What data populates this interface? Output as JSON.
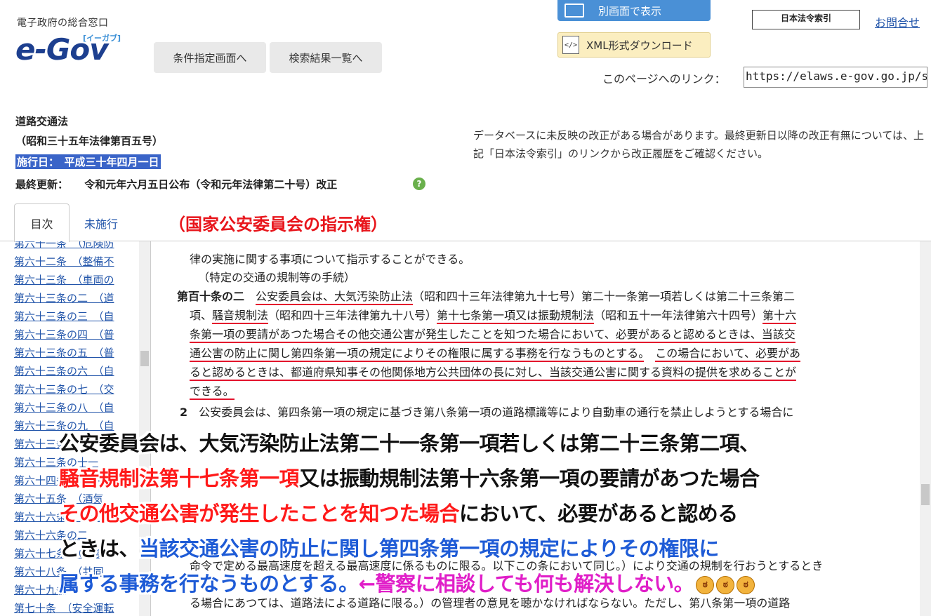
{
  "header": {
    "logo_sub": "電子政府の総合窓口",
    "logo_main": "e-Gov",
    "logo_kana": "[イーガブ]",
    "btn_condition": "条件指定画面へ",
    "btn_results": "検索結果一覧へ",
    "btn_new_window": "別画面で表示",
    "btn_xml": "XML形式ダウンロード",
    "hourei_logo": "日本法令索引",
    "contact": "お問合せ",
    "page_link_label": "このページへのリンク：",
    "page_link_value": "https://elaws.e-gov.go.jp/sea"
  },
  "law": {
    "title": "道路交通法",
    "number": "（昭和三十五年法律第百五号）",
    "effective": "施行日：　平成三十年四月一日",
    "update_label": "最終更新：",
    "update_value": "令和元年六月五日公布（令和元年法律第二十号）改正",
    "db_note": "データベースに未反映の改正がある場合があります。最終更新日以降の改正有無については、上記「日本法令索引」のリンクから改正履歴をご確認ください。"
  },
  "tabs": {
    "toc": "目次",
    "unenforced": "未施行"
  },
  "heading_red": "（国家公安委員会の指示権）",
  "sidebar": {
    "items": [
      "第六十一条　（危険防",
      "第六十二条　（整備不",
      "第六十三条　（車両の",
      "第六十三条の二　（道",
      "第六十三条の三　（自",
      "第六十三条の四　（普",
      "第六十三条の五　（普",
      "第六十三条の六　（自",
      "第六十三条の七　（交",
      "第六十三条の八　（自",
      "第六十三条の九　（自",
      "第六十三条の十　（",
      "第六十三条の十一",
      "第六十四条　（無免",
      "第六十五条　（酒気",
      "第六十六条　（過労",
      "第六十六条の二",
      "第六十七条　（危険",
      "第六十八条　（共同",
      "第六十九条",
      "第七十条　（安全運転"
    ]
  },
  "main": {
    "line1": "律の実施に関する事項について指示することができる。",
    "line2": "（特定の交通の規制等の手続）",
    "art_num": "第百十条の二",
    "l3a": "公安委員会は、大気汚染防止法",
    "l3b": "（昭和四十三年法律第九十七号）第二十一条第一項若しくは第二十三条第二",
    "l4a": "項、",
    "l4b": "騒音規制法",
    "l4c": "（昭和四十三年法律第九十八号）",
    "l4d": "第十七条第一項又は振動規制法",
    "l4e": "（昭和五十一年法律第六十四号）",
    "l4f": "第十六",
    "l5a": "条第一項の要請があつた場合その他交通公害が発生したことを知つた場合において、必要があると認めるときは、",
    "l5b": "当該交",
    "l6a": "通公害の防止に関し第四条第一項の規定によりその権限に属する事務を行なうものとする。",
    "l6b": "この場合において、必要があ",
    "l7": "ると認めるときは、都道府県知事その他関係地方公共団体の長に対し、当該交通公害に関する資料の提供を求めることが",
    "l8": "できる。",
    "para2_num": "2",
    "l9": "公安委員会は、第四条第一項の規定に基づき第八条第一項の道路標識等により自動車の通行を禁止しようとする場合に",
    "l10": "命令で定める最高速度を超える最高速度に係るものに限る。以下この条において同じ。）により交通の規制を行おうとするとき",
    "l11": "る場合にあつては、道路法による道路に限る。）の管理者の意見を聴かなければならない。ただし、第八条第一項の道路"
  },
  "overlay": {
    "line1": "公安委員会は、大気汚染防止法第二十一条第一項若しくは第二十三条第二項、",
    "line2_red": "騒音規制法第十七条第一項",
    "line2_black": "又は振動規制法第十六条第一項の要請があつた場合",
    "line3_red": "その他交通公害が発生したことを知つた場合",
    "line3_black": "において、必要があると認める",
    "line4_black": "ときは、",
    "line4_blue": "当該交通公害の防止に関し第四条第一項の規定によりその権限に",
    "line5_blue": "属する事務を行なうものとする。",
    "line5_magenta": "←警察に相談しても何も解決しない。"
  },
  "colors": {
    "accent_blue": "#4a90d6",
    "highlight_red": "#ff1a1a",
    "overlay_blue": "#1e5bd6",
    "overlay_magenta": "#e01ec8",
    "link": "#2255aa"
  },
  "icons": {
    "new_window": "window-icon",
    "xml": "xml-file-icon",
    "help": "help-icon",
    "emoji": "angry-face-icon"
  }
}
